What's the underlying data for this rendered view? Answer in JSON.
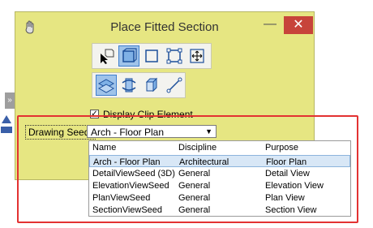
{
  "window": {
    "title": "Place Fitted Section",
    "minimize": "—",
    "close": "✕"
  },
  "side_tab": "»",
  "toolbar_top": {
    "icons": [
      "select-pointer-icon",
      "fitted-volume-icon",
      "rectangle-icon",
      "points-rectangle-icon",
      "resize-icon"
    ],
    "active_index": 1
  },
  "toolbar_bottom": {
    "icons": [
      "clip-volume-icon",
      "rotate-axis-icon",
      "cube-rotate-icon",
      "line-tool-icon"
    ],
    "active_index": 0
  },
  "display_clip": {
    "label": "Display Clip Element",
    "checked": true,
    "mark": "✓"
  },
  "drawing_seed": {
    "label": "Drawing Seed:",
    "value": "Arch - Floor Plan",
    "columns": [
      "Name",
      "Discipline",
      "Purpose"
    ],
    "rows": [
      [
        "Arch - Floor Plan",
        "Architectural",
        "Floor Plan"
      ],
      [
        "DetailViewSeed (3D)",
        "General",
        "Detail View"
      ],
      [
        "ElevationViewSeed",
        "General",
        "Elevation View"
      ],
      [
        "PlanViewSeed",
        "General",
        "Plan View"
      ],
      [
        "SectionViewSeed",
        "General",
        "Section View"
      ]
    ],
    "selected_row": 0
  },
  "colors": {
    "window_bg": "#e6e682",
    "highlight": "#e33232",
    "selected_row": "#d8e7f6",
    "close_button": "#c7443a"
  }
}
